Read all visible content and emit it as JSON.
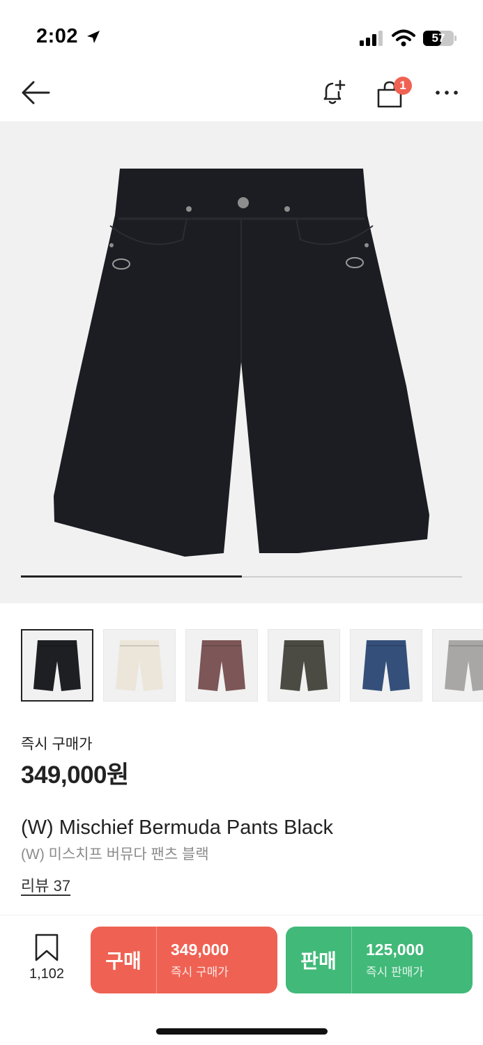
{
  "status_bar": {
    "time": "2:02",
    "battery": "57"
  },
  "header": {
    "cart_badge": "1"
  },
  "gallery": {
    "progress_fraction": 0.5
  },
  "thumbnails": [
    {
      "color": "#1e1f23",
      "label": "black"
    },
    {
      "color": "#ece6da",
      "label": "cream"
    },
    {
      "color": "#7d5658",
      "label": "burgundy"
    },
    {
      "color": "#4b4b43",
      "label": "washed-grey"
    },
    {
      "color": "#34507a",
      "label": "blue-denim"
    },
    {
      "color": "#a9a7a5",
      "label": "light-grey"
    }
  ],
  "product": {
    "price_label": "즉시 구매가",
    "price": "349,000원",
    "name_en": "(W) Mischief Bermuda Pants Black",
    "name_ko": "(W) 미스치프 버뮤다 팬츠 블랙",
    "reviews": "리뷰 37"
  },
  "bottom_bar": {
    "bookmark_count": "1,102",
    "buy": {
      "label": "구매",
      "amount": "349,000",
      "sub": "즉시 구매가",
      "color": "#ef6253"
    },
    "sell": {
      "label": "판매",
      "amount": "125,000",
      "sub": "즉시 판매가",
      "color": "#41b979"
    }
  }
}
